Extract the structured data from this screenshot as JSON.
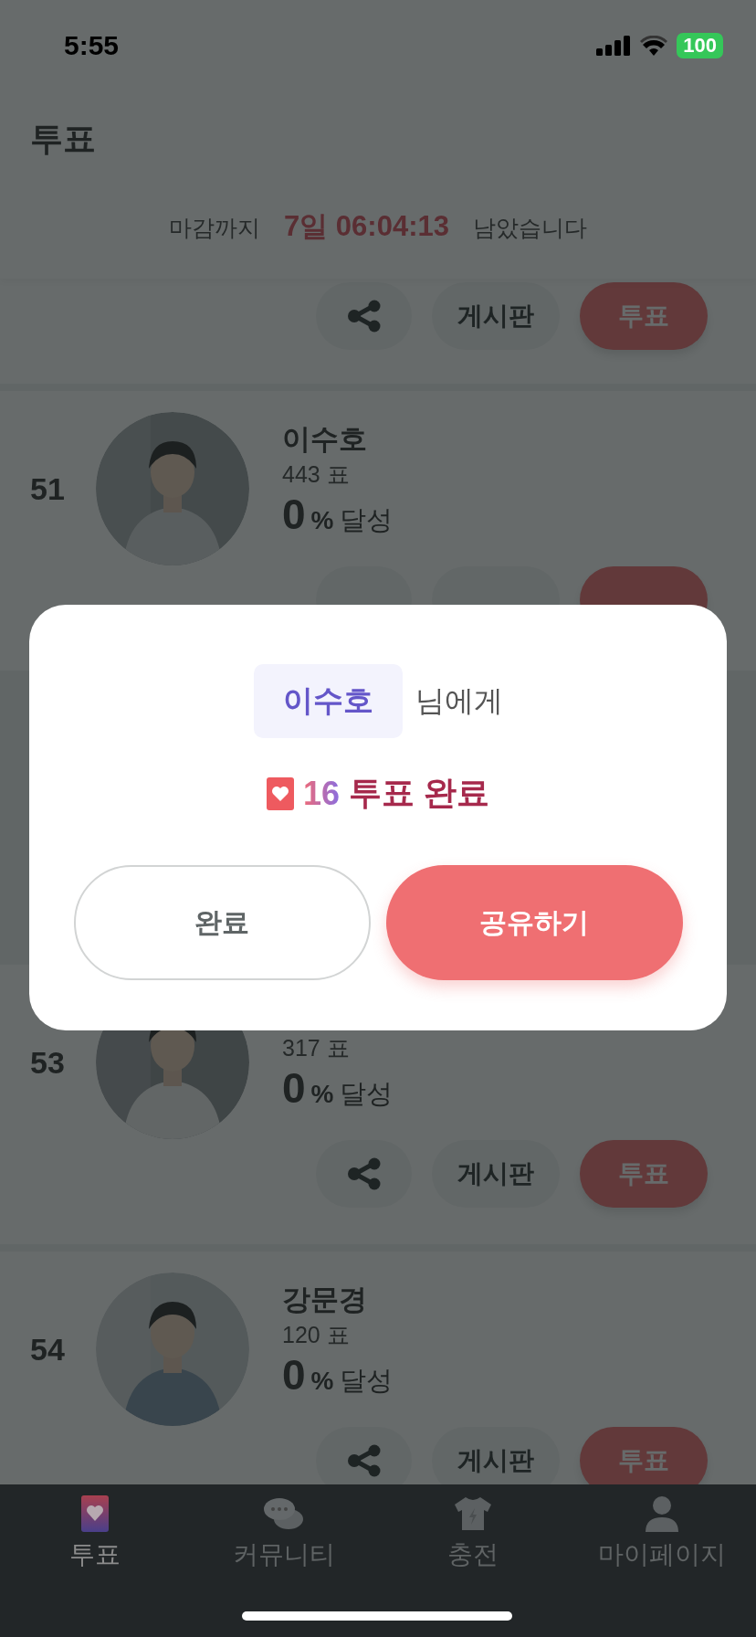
{
  "status_bar": {
    "time": "5:55",
    "battery": "100"
  },
  "header": {
    "title": "투표"
  },
  "countdown": {
    "prefix": "마감까지",
    "time": "7일 06:04:13",
    "suffix": "남았습니다"
  },
  "candidates": [
    {
      "kind": "partial",
      "board": "게시판",
      "vote": "투표"
    },
    {
      "kind": "covered",
      "rank": "51",
      "name": "이수호",
      "votes": "443 표",
      "percent": "0",
      "percent_unit": "%",
      "achieved": "달성"
    },
    {
      "kind": "full",
      "rank": "53",
      "votes": "317 표",
      "percent": "0",
      "percent_unit": "%",
      "achieved": "달성",
      "board": "게시판",
      "vote": "투표"
    },
    {
      "kind": "full",
      "rank": "54",
      "name": "강문경",
      "votes": "120 표",
      "percent": "0",
      "percent_unit": "%",
      "achieved": "달성",
      "board": "게시판",
      "vote": "투표"
    }
  ],
  "dialog": {
    "name": "이수호",
    "suffix": "님에게",
    "count": "16",
    "result": "투표 완료",
    "buttons": [
      {
        "label": "완료",
        "kind": "secondary"
      },
      {
        "label": "공유하기",
        "kind": "primary"
      }
    ]
  },
  "tab_bar": [
    {
      "label": "투표",
      "kind": "vote",
      "selected": true
    },
    {
      "label": "커뮤니티",
      "kind": "community",
      "selected": false
    },
    {
      "label": "충전",
      "kind": "charge",
      "selected": false
    },
    {
      "label": "마이페이지",
      "kind": "mypage",
      "selected": false
    }
  ]
}
